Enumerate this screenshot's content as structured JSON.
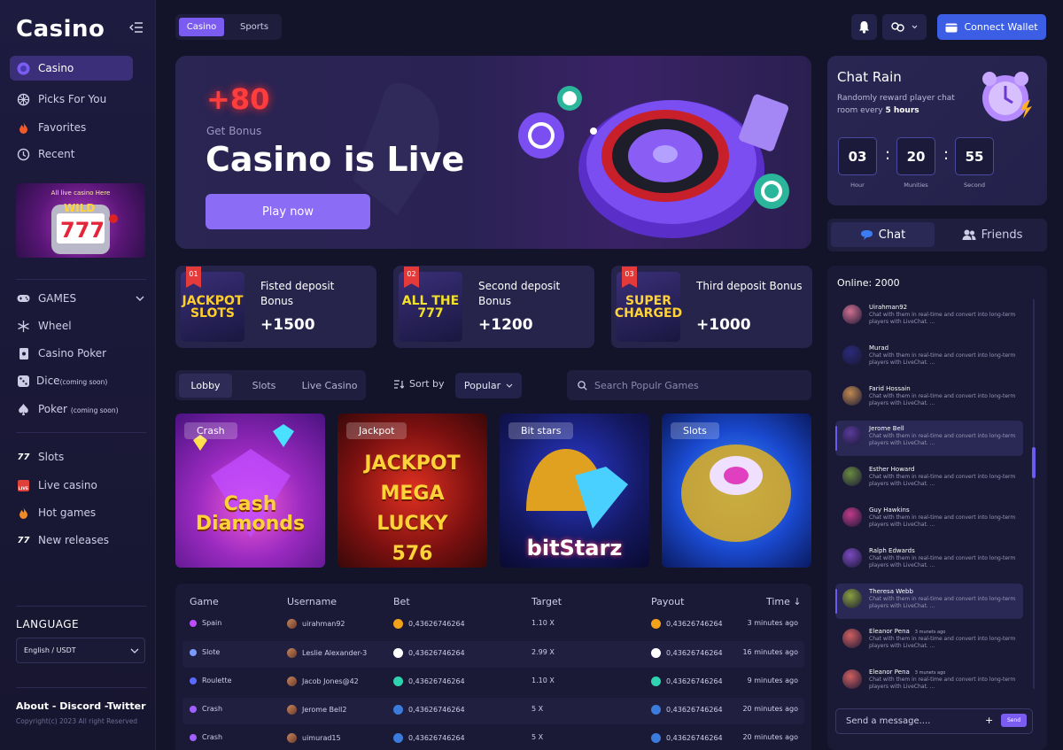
{
  "brand": "Casino",
  "sidebar": {
    "main_nav": [
      {
        "label": "Casino",
        "icon": "casino-chip-icon"
      },
      {
        "label": "Picks For You",
        "icon": "wheel-icon"
      },
      {
        "label": "Favorites",
        "icon": "flame-icon"
      },
      {
        "label": "Recent",
        "icon": "clock-icon"
      }
    ],
    "promo_text": "All live casino Here",
    "games_header": "GAMES",
    "games": [
      {
        "label": "Wheel",
        "suffix": "",
        "icon": "snowflake-wheel-icon"
      },
      {
        "label": "Casino Poker",
        "suffix": "",
        "icon": "card-icon"
      },
      {
        "label": "Dice",
        "suffix": "(coming soon)",
        "icon": "dice-icon"
      },
      {
        "label": "Poker ",
        "suffix": "(coming soon)",
        "icon": "spade-icon"
      }
    ],
    "extra": [
      {
        "label": "Slots",
        "icon": "seven-seven-icon"
      },
      {
        "label": "Live casino",
        "icon": "live-icon"
      },
      {
        "label": "Hot games",
        "icon": "flame-icon"
      },
      {
        "label": "New releases",
        "icon": "seven-seven-icon"
      }
    ],
    "language_title": "LANGUAGE",
    "language_value": "English / USDT",
    "footer_links": "About - Discord -Twitter",
    "copyright": "Copyright(c) 2023 All right Reserved"
  },
  "topbar": {
    "tabs": [
      "Casino",
      "Sports"
    ],
    "active_tab": "Casino",
    "wallet_label": "Connect Wallet"
  },
  "hero": {
    "bonus": "+80",
    "bonus_label": "Get Bonus",
    "title": "Casino is Live",
    "cta": "Play now"
  },
  "deposits": [
    {
      "badge": "01",
      "title": "Fisted deposit Bonus",
      "amount": "+1500",
      "art": "JACKPOT SLOTS"
    },
    {
      "badge": "02",
      "title": "Second deposit Bonus",
      "amount": "+1200",
      "art": "ALL THE 777"
    },
    {
      "badge": "03",
      "title": "Third deposit Bonus",
      "amount": "+1000",
      "art": "SUPER CHARGED"
    }
  ],
  "filters": {
    "tabs": [
      "Lobby",
      "Slots",
      "Live Casino"
    ],
    "active_tab": "Lobby",
    "sort_label": "Sort by",
    "sort_value": "Popular",
    "search_placeholder": "Search Populr Games"
  },
  "games": [
    {
      "tag": "Crash",
      "title": "Cash Diamonds"
    },
    {
      "tag": "Jackpot",
      "title": "JACKPOT MEGA LUCKY 576"
    },
    {
      "tag": "Bit stars",
      "title": "bitStarz"
    },
    {
      "tag": "Slots",
      "title": ""
    }
  ],
  "table": {
    "headers": [
      "Game",
      "Username",
      "Bet",
      "Target",
      "Payout",
      "Time ↓"
    ],
    "rows": [
      {
        "game": "Spain",
        "user": "uirahman92",
        "bet": "0,43626746264",
        "target": "1.10 X",
        "payout": "0,43626746264",
        "time": "3 minutes ago",
        "coin": "#f2a21a"
      },
      {
        "game": "Slote",
        "user": "Leslie Alexander-3",
        "bet": "0,43626746264",
        "target": "2.99 X",
        "payout": "0,43626746264",
        "time": "16 minutes ago",
        "coin": "#ffffff"
      },
      {
        "game": "Roulette",
        "user": "Jacob Jones@42",
        "bet": "0,43626746264",
        "target": "1.10 X",
        "payout": "0,43626746264",
        "time": "9 minutes ago",
        "coin": "#2fd3b0"
      },
      {
        "game": "Crash",
        "user": "Jerome Bell2",
        "bet": "0,43626746264",
        "target": "5 X",
        "payout": "0,43626746264",
        "time": "20 minutes ago",
        "coin": "#3a7bdc"
      },
      {
        "game": "Crash",
        "user": "uimurad15",
        "bet": "0,43626746264",
        "target": "5 X",
        "payout": "0,43626746264",
        "time": "20 minutes ago",
        "coin": "#3a7bdc"
      }
    ]
  },
  "chat_rain": {
    "title": "Chat Rain",
    "desc_prefix": "Randomly reward player chat room every ",
    "desc_bold": "5 hours",
    "hours": "03",
    "minutes": "20",
    "seconds": "55",
    "hours_label": "Hour",
    "minutes_label": "Munities",
    "seconds_label": "Second"
  },
  "chat": {
    "tabs": [
      "Chat",
      "Friends"
    ],
    "online": "Online: 2000",
    "messages": [
      {
        "name": "Uirahman92",
        "time": "",
        "text": "Chat with them in real-time and convert into long-term players with LiveChat. ..."
      },
      {
        "name": "Murad",
        "time": "",
        "text": "Chat with them in real-time and convert into long-term players with LiveChat. ..."
      },
      {
        "name": "Farid Hossain",
        "time": "",
        "text": "Chat with them in real-time and convert into long-term players with LiveChat. ..."
      },
      {
        "name": "Jerome Bell",
        "time": "",
        "text": "Chat with them in real-time and convert into long-term players with LiveChat. ..."
      },
      {
        "name": "Esther Howard",
        "time": "",
        "text": "Chat with them in real-time and convert into long-term players with LiveChat. ..."
      },
      {
        "name": "Guy Hawkins",
        "time": "",
        "text": "Chat with them in real-time and convert into long-term players with LiveChat. ..."
      },
      {
        "name": "Ralph Edwards",
        "time": "",
        "text": "Chat with them in real-time and convert into long-term players with LiveChat. ..."
      },
      {
        "name": "Theresa Webb",
        "time": "",
        "text": "Chat with them in real-time and convert into long-term players with LiveChat. ..."
      },
      {
        "name": "Eleanor Pena",
        "time": "3 munets ago",
        "text": "Chat with them in real-time and convert into long-term players with LiveChat. ..."
      },
      {
        "name": "Eleanor Pena",
        "time": "3 munets ago",
        "text": "Chat with them in real-time and convert into long-term players with LiveChat. ..."
      }
    ],
    "input_placeholder": "Send a message....",
    "send_label": "Send",
    "plus": "+"
  },
  "colors": {
    "accent": "#8b6cf5",
    "wallet": "#3c5ee4",
    "bonus_red": "#ff3d3d"
  }
}
